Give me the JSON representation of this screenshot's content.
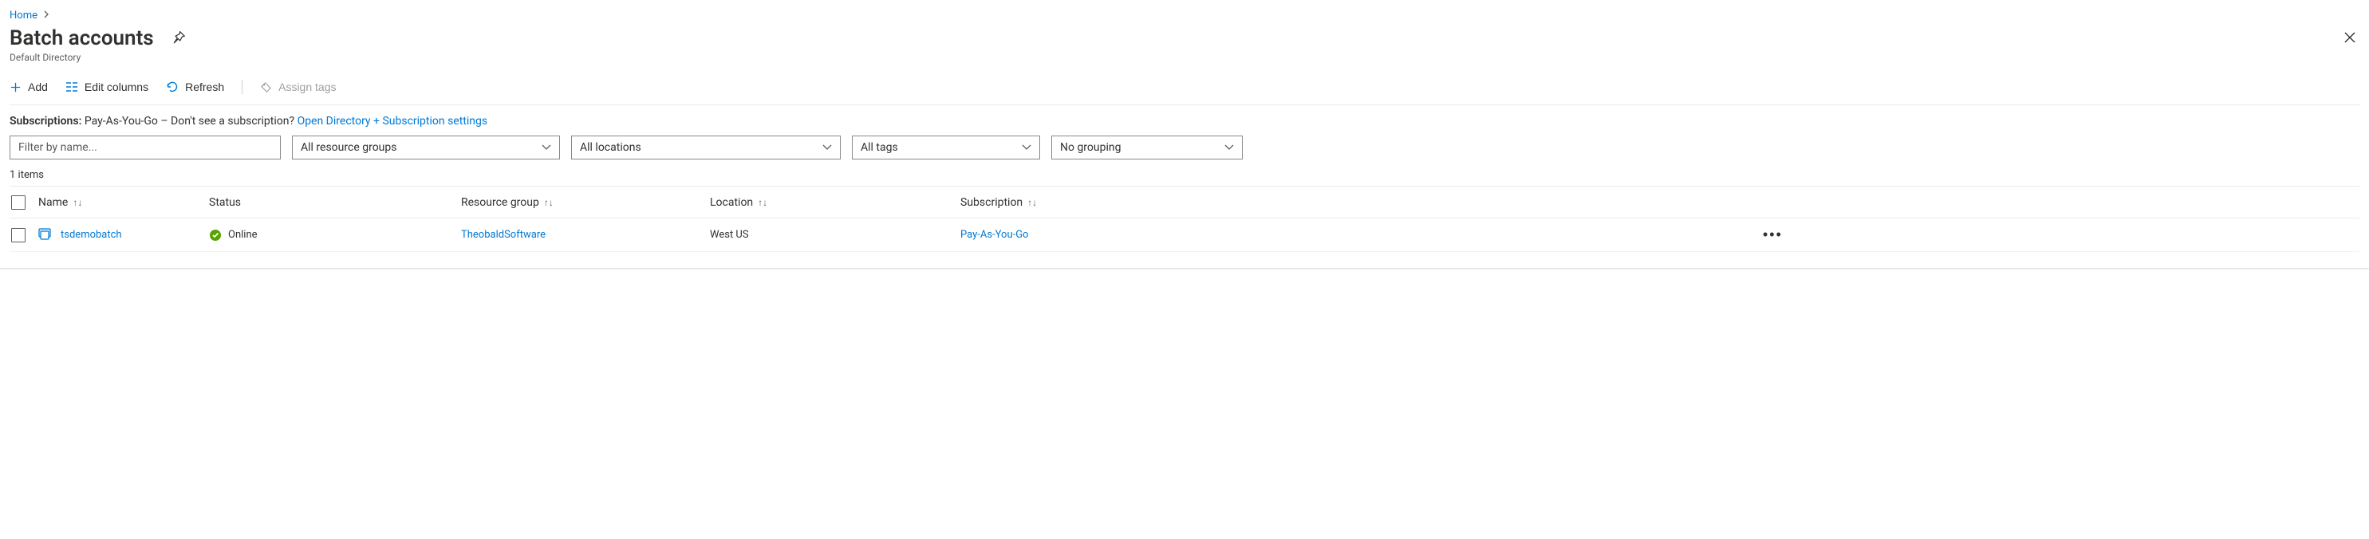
{
  "breadcrumb": {
    "home": "Home"
  },
  "header": {
    "title": "Batch accounts",
    "subtitle": "Default Directory"
  },
  "toolbar": {
    "add": "Add",
    "edit_columns": "Edit columns",
    "refresh": "Refresh",
    "assign_tags": "Assign tags"
  },
  "subscriptions": {
    "label": "Subscriptions:",
    "text": "Pay-As-You-Go – Don't see a subscription?",
    "link": "Open Directory + Subscription settings"
  },
  "filters": {
    "name_placeholder": "Filter by name...",
    "resource_groups": "All resource groups",
    "locations": "All locations",
    "tags": "All tags",
    "grouping": "No grouping"
  },
  "count": "1 items",
  "columns": {
    "name": "Name",
    "status": "Status",
    "resource_group": "Resource group",
    "location": "Location",
    "subscription": "Subscription"
  },
  "rows": [
    {
      "name": "tsdemobatch",
      "status": "Online",
      "resource_group": "TheobaldSoftware",
      "location": "West US",
      "subscription": "Pay-As-You-Go"
    }
  ]
}
